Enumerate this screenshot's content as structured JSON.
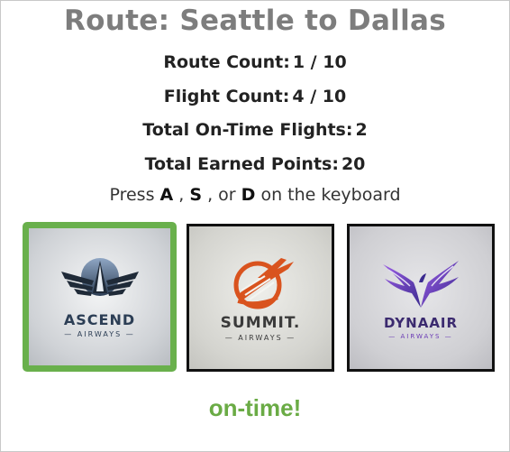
{
  "header": {
    "title": "Route: Seattle to Dallas"
  },
  "stats": {
    "route_count_label": "Route Count:",
    "route_count_value": "1 / 10",
    "flight_count_label": "Flight Count:",
    "flight_count_value": "4 / 10",
    "on_time_label": "Total On-Time Flights:",
    "on_time_value": "2",
    "points_label": "Total Earned Points:",
    "points_value": "20"
  },
  "instructions": {
    "prefix": "Press ",
    "key_a": "A",
    "sep1": " , ",
    "key_s": "S",
    "sep2": " , or ",
    "key_d": "D",
    "suffix": " on the keyboard"
  },
  "airlines": [
    {
      "name": "ASCEND",
      "sub": "— AIRWAYS —",
      "icon": "ascend-wings-logo",
      "selected": true,
      "color": "#2c3e55"
    },
    {
      "name": "SUMMIT.",
      "sub": "— AIRWAYS —",
      "icon": "summit-plane-logo",
      "selected": false,
      "color": "#d9531e"
    },
    {
      "name": "DYNAAIR",
      "sub": "— AIRWAYS —",
      "icon": "dynaair-phoenix-logo",
      "selected": false,
      "color": "#6a3ab5"
    }
  ],
  "feedback": {
    "text": "on-time!",
    "color": "#6aab45"
  },
  "colors": {
    "selected_border": "#69b04c",
    "title": "#7d7d7d"
  }
}
